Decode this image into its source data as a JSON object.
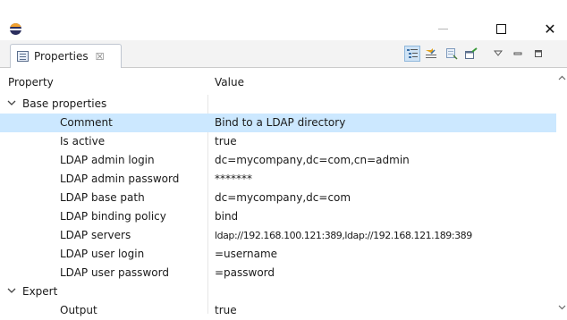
{
  "window": {
    "app_icon": "eclipse-icon",
    "minimize_icon": "minimize-icon",
    "maximize_icon": "maximize-icon",
    "close_glyph": "✕"
  },
  "view": {
    "tab_label": "Properties",
    "tab_close_glyph": "☒",
    "toolbar": [
      "show-categories-icon",
      "show-advanced-properties-icon",
      "restore-default-icon",
      "pin-icon",
      "view-menu-icon",
      "minimize-view-icon",
      "maximize-view-icon"
    ]
  },
  "table": {
    "columns": {
      "property": "Property",
      "value": "Value"
    },
    "groups": [
      {
        "label": "Base properties",
        "expanded": true,
        "rows": [
          {
            "property": "Comment",
            "value": "Bind to a LDAP directory",
            "selected": true
          },
          {
            "property": "Is active",
            "value": "true"
          },
          {
            "property": "LDAP admin login",
            "value": "dc=mycompany,dc=com,cn=admin"
          },
          {
            "property": "LDAP admin password",
            "value": "*******"
          },
          {
            "property": "LDAP base path",
            "value": "dc=mycompany,dc=com"
          },
          {
            "property": "LDAP binding policy",
            "value": "bind"
          },
          {
            "property": "LDAP servers",
            "value": "ldap://192.168.100.121:389,ldap://192.168.121.189:389"
          },
          {
            "property": "LDAP user login",
            "value": "=username"
          },
          {
            "property": "LDAP user password",
            "value": "=password"
          }
        ]
      },
      {
        "label": "Expert",
        "expanded": true,
        "rows": [
          {
            "property": "Output",
            "value": "true"
          }
        ]
      }
    ]
  },
  "colors": {
    "selection": "#cce8ff",
    "tab_strip": "#f3f3f3"
  }
}
